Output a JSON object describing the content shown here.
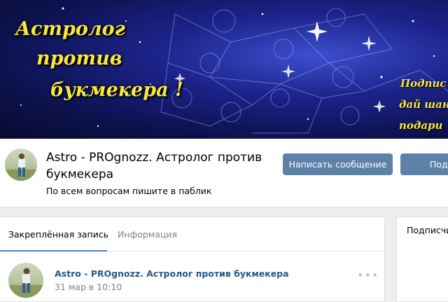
{
  "cover": {
    "title_lines": [
      "Астролог",
      "против",
      "букмекера !"
    ],
    "side_lines": [
      "Подпис",
      "дай шан",
      "подари"
    ]
  },
  "group": {
    "name": "Astro - PROgnozz. Астролог против букмекера",
    "status": "По всем вопросам пишите в паблик",
    "message_button": "Написать сообщение",
    "subscribe_button": "Подп"
  },
  "wall": {
    "tabs": [
      {
        "label": "Закреплённая запись",
        "active": true
      },
      {
        "label": "Информация",
        "active": false
      }
    ],
    "post": {
      "author": "Astro - PROgnozz. Астролог против букмекера",
      "date": "31 мар в 10:10",
      "more": "•••"
    }
  },
  "side": {
    "title": "Подписчи"
  },
  "colors": {
    "accent": "#5181b8",
    "button": "#5e81a8",
    "link": "#2a5885",
    "cover_text": "#f7e83a"
  }
}
